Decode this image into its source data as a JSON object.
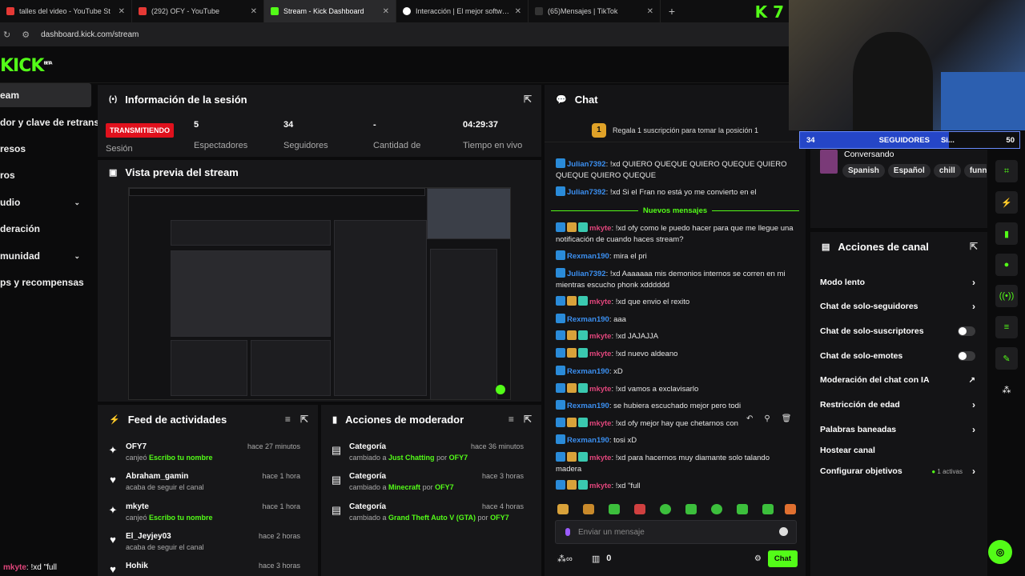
{
  "browser": {
    "tabs": [
      {
        "label": "talles del video - YouTube St",
        "color": "#e53935"
      },
      {
        "label": "(292) OFY - YouTube",
        "color": "#e53935"
      },
      {
        "label": "Stream - Kick Dashboard",
        "color": "#53fc18"
      },
      {
        "label": "Interacción | El mejor software",
        "color": "#ffffff"
      },
      {
        "label": "(65)Mensajes | TikTok",
        "color": "#222222"
      }
    ],
    "new_tab": "+",
    "url": "dashboard.kick.com/stream",
    "kick_top_logo": "K 7"
  },
  "header": {
    "logo": "KICK",
    "logo_beta": "BETA"
  },
  "sidebar": {
    "items": [
      {
        "label": "eam"
      },
      {
        "label": "dor y clave de retransm"
      },
      {
        "label": "resos"
      },
      {
        "label": "ros"
      },
      {
        "label": "udio"
      },
      {
        "label": "deración"
      },
      {
        "label": "munidad"
      },
      {
        "label": "ps y recompensas"
      }
    ]
  },
  "session": {
    "title": "Información de la sesión",
    "live_badge": "TRANSMITIENDO",
    "status_label": "Sesión",
    "stats": [
      {
        "value": "5",
        "label": "Espectadores"
      },
      {
        "value": "34",
        "label": "Seguidores"
      },
      {
        "value": "-",
        "label": "Cantidad de"
      },
      {
        "value": "04:29:37",
        "label": "Tiempo en vivo"
      }
    ]
  },
  "preview": {
    "title": "Vista previa del stream"
  },
  "activity": {
    "title": "Feed de actividades",
    "items": [
      {
        "name": "OFY7",
        "sub_pre": "canjeó",
        "sub_hl": "Escribo tu nombre",
        "time": "hace 27 minutos",
        "icon": "redeem-icon"
      },
      {
        "name": "Abraham_gamin",
        "sub_pre": "acaba de seguir el canal",
        "sub_hl": "",
        "time": "hace 1 hora",
        "icon": "heart-icon"
      },
      {
        "name": "mkyte",
        "sub_pre": "canjeó",
        "sub_hl": "Escribo tu nombre",
        "time": "hace 1 hora",
        "icon": "redeem-icon"
      },
      {
        "name": "El_Jeyjey03",
        "sub_pre": "acaba de seguir el canal",
        "sub_hl": "",
        "time": "hace 2 horas",
        "icon": "heart-icon"
      },
      {
        "name": "Hohik",
        "sub_pre": "",
        "sub_hl": "",
        "time": "hace 3 horas",
        "icon": "heart-icon"
      }
    ]
  },
  "mod_actions": {
    "title": "Acciones de moderador",
    "items": [
      {
        "name": "Categoría",
        "pre": "cambiado a",
        "hl": "Just Chatting",
        "by": "por",
        "user": "OFY7",
        "time": "hace 36 minutos"
      },
      {
        "name": "Categoría",
        "pre": "cambiado a",
        "hl": "Minecraft",
        "by": "por",
        "user": "OFY7",
        "time": "hace 3 horas"
      },
      {
        "name": "Categoría",
        "pre": "cambiado a",
        "hl": "Grand Theft Auto V (GTA)",
        "by": "por",
        "user": "OFY7",
        "time": "hace 4 horas"
      }
    ]
  },
  "chat": {
    "title": "Chat",
    "gift_badge": "1",
    "gift_text": "Regala 1 suscripción para tomar la posición 1",
    "new_messages": "Nuevos mensajes",
    "input_placeholder": "Enviar un mensaje",
    "send": "Chat",
    "points": "0",
    "messages": [
      {
        "user": "Julian7392",
        "color": "#3b8ff0",
        "badges": [
          "b-blue"
        ],
        "text": ": !xd QUIERO QUEQUE QUIERO QUEQUE QUIERO QUEQUE QUIERO QUEQUE"
      },
      {
        "user": "Julian7392",
        "color": "#3b8ff0",
        "badges": [
          "b-blue"
        ],
        "text": ": !xd Si el Fran no está yo me convierto en el"
      },
      {
        "user": "mkyte",
        "color": "#e0457b",
        "badges": [
          "b-blue",
          "b-gold",
          "b-teal"
        ],
        "text": ": !xd ofy como le puedo hacer para que me llegue una notificación de cuando haces stream?"
      },
      {
        "user": "Rexman190",
        "color": "#3b8ff0",
        "badges": [
          "b-blue"
        ],
        "text": ": mira el pri"
      },
      {
        "user": "Julian7392",
        "color": "#3b8ff0",
        "badges": [
          "b-blue"
        ],
        "text": ": !xd Aaaaaaa mis demonios internos se corren en mi mientras escucho phonk xdddddd"
      },
      {
        "user": "mkyte",
        "color": "#e0457b",
        "badges": [
          "b-blue",
          "b-gold",
          "b-teal"
        ],
        "text": ": !xd que envio el rexito"
      },
      {
        "user": "Rexman190",
        "color": "#3b8ff0",
        "badges": [
          "b-blue"
        ],
        "text": ": aaa"
      },
      {
        "user": "mkyte",
        "color": "#e0457b",
        "badges": [
          "b-blue",
          "b-gold",
          "b-teal"
        ],
        "text": ": !xd JAJAJJA"
      },
      {
        "user": "mkyte",
        "color": "#e0457b",
        "badges": [
          "b-blue",
          "b-gold",
          "b-teal"
        ],
        "text": ": !xd nuevo aldeano"
      },
      {
        "user": "Rexman190",
        "color": "#3b8ff0",
        "badges": [
          "b-blue"
        ],
        "text": ": xD"
      },
      {
        "user": "mkyte",
        "color": "#e0457b",
        "badges": [
          "b-blue",
          "b-gold",
          "b-teal"
        ],
        "text": ": !xd vamos a exclavisarlo"
      },
      {
        "user": "Rexman190",
        "color": "#3b8ff0",
        "badges": [
          "b-blue"
        ],
        "text": ": se hubiera escuchado mejor pero todi"
      },
      {
        "user": "mkyte",
        "color": "#e0457b",
        "badges": [
          "b-blue",
          "b-gold",
          "b-teal"
        ],
        "text": ": !xd ofy mejor hay que chetarnos con"
      },
      {
        "user": "Rexman190",
        "color": "#3b8ff0",
        "badges": [
          "b-blue"
        ],
        "text": ": tosi xD"
      },
      {
        "user": "mkyte",
        "color": "#e0457b",
        "badges": [
          "b-blue",
          "b-gold",
          "b-teal"
        ],
        "text": ": !xd para hacernos muy diamante solo talando madera"
      },
      {
        "user": "mkyte",
        "color": "#e0457b",
        "badges": [
          "b-blue",
          "b-gold",
          "b-teal"
        ],
        "text": ": !xd \"full"
      }
    ]
  },
  "webcam_overlay": {
    "followers": "34",
    "label": "SEGUIDORES",
    "extra": "Si...",
    "goal": "50"
  },
  "stream_info": {
    "category": "Conversando",
    "tags": [
      "Spanish",
      "Español",
      "chill",
      "funn"
    ]
  },
  "channel_actions": {
    "title": "Acciones de canal",
    "items": [
      {
        "label": "Modo lento",
        "control": "arrow"
      },
      {
        "label": "Chat de solo-seguidores",
        "control": "arrow"
      },
      {
        "label": "Chat de solo-suscriptores",
        "control": "toggle"
      },
      {
        "label": "Chat de solo-emotes",
        "control": "toggle"
      },
      {
        "label": "Moderación del chat con IA",
        "control": "external"
      },
      {
        "label": "Restricción de edad",
        "control": "arrow"
      },
      {
        "label": "Palabras baneadas",
        "control": "arrow"
      },
      {
        "label": "Hostear canal",
        "control": "none"
      },
      {
        "label": "Configurar objetivos",
        "control": "arrow"
      }
    ],
    "goals_active": "1 activas"
  },
  "bottom_overlay": {
    "user": "mkyte",
    "text": ": !xd \"full"
  }
}
